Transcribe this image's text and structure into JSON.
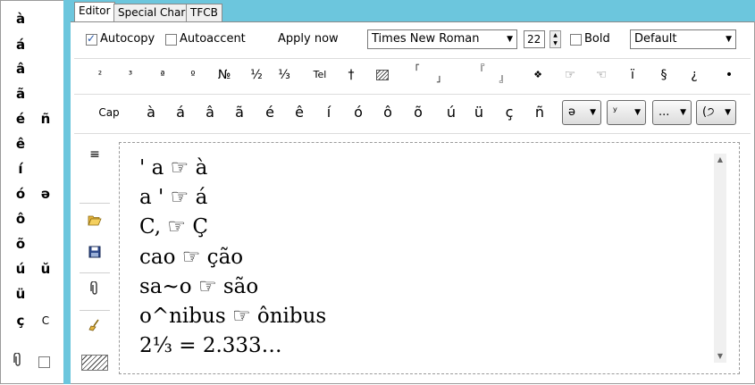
{
  "left_chars": {
    "col1": [
      "à",
      "á",
      "â",
      "ã",
      "é",
      "ê",
      "í",
      "ó",
      "ô",
      "õ",
      "ú",
      "ü",
      "ç"
    ],
    "col2": [
      {
        "char": "ñ",
        "row": 4
      },
      {
        "char": "ə",
        "row": 7
      },
      {
        "char": "ŭ",
        "row": 10
      },
      {
        "char": "C",
        "row": 12
      }
    ]
  },
  "tabs": [
    "Editor",
    "Special Chars",
    "TFCB"
  ],
  "toolbar": {
    "autocopy_label": "Autocopy",
    "autocopy_checked": true,
    "autoaccent_label": "Autoaccent",
    "autoaccent_checked": false,
    "apply_now_label": "Apply now",
    "font_family": "Times New Roman",
    "font_size": "22",
    "bold_label": "Bold",
    "bold_checked": false,
    "style_select": "Default"
  },
  "symbols": [
    "²",
    "³",
    "ª",
    "º",
    "№",
    "½",
    "⅓",
    "Tel",
    "†",
    "",
    "「",
    "」",
    "『",
    "』",
    "❖",
    "☞",
    "☜",
    "ï",
    "§",
    "¿",
    "•"
  ],
  "accent_row": {
    "cap_label": "Cap",
    "chars": [
      "à",
      "á",
      "â",
      "ã",
      "é",
      "ê",
      "í",
      "ó",
      "ô",
      "õ",
      "ú",
      "ü",
      "ç",
      "ñ"
    ],
    "dropdowns": [
      "ə",
      "ʸ",
      "...",
      "(੭"
    ]
  },
  "editor_lines": [
    "' a ☞ à",
    "a ' ☞ á",
    "C, ☞ Ç",
    "cao ☞ ção",
    "sa~o ☞ são",
    "o^nibus ☞ ônibus",
    "2⅓ = 2.333…"
  ],
  "colors": {
    "accent_band": "#6cc6dd",
    "check": "#2b5aa8"
  }
}
